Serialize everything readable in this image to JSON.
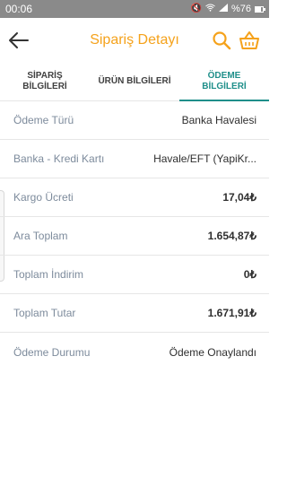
{
  "status_bar": {
    "time": "00:06",
    "battery_percent": "%76"
  },
  "header": {
    "title": "Sipariş Detayı"
  },
  "tabs": [
    {
      "label": "SİPARİŞ\nBİLGİLERİ"
    },
    {
      "label": "ÜRÜN BİLGİLERİ"
    },
    {
      "label": "ÖDEME\nBİLGİLERİ"
    }
  ],
  "payment_info": {
    "rows": [
      {
        "label": "Ödeme Türü",
        "value": "Banka Havalesi"
      },
      {
        "label": "Banka - Kredi Kartı",
        "value": "Havale/EFT (YapiKr..."
      },
      {
        "label": "Kargo Ücreti",
        "value": "17,04₺"
      },
      {
        "label": "Ara Toplam",
        "value": "1.654,87₺"
      },
      {
        "label": "Toplam İndirim",
        "value": "0₺"
      },
      {
        "label": "Toplam Tutar",
        "value": "1.671,91₺"
      },
      {
        "label": "Ödeme Durumu",
        "value": "Ödeme Onaylandı"
      }
    ]
  },
  "colors": {
    "accent_orange": "#f5a21b",
    "active_tab": "#1f8f8a",
    "label_gray": "#7d8b9c"
  },
  "icons": {
    "back": "arrow-left-icon",
    "search": "search-icon",
    "basket": "basket-icon"
  },
  "battery_level": 0.76
}
